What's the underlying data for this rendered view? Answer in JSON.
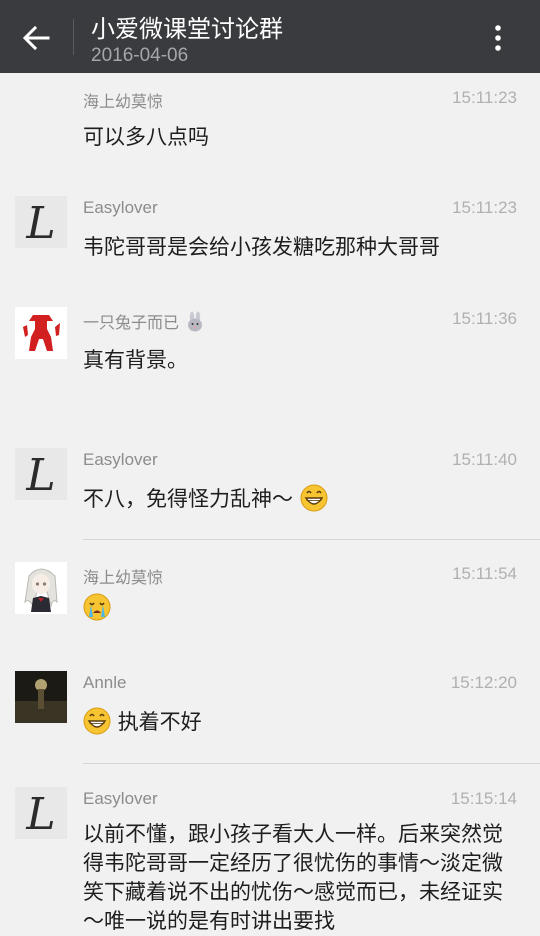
{
  "header": {
    "title": "小爱微课堂讨论群",
    "date": "2016-04-06",
    "back_icon": "arrow-left-icon",
    "more_icon": "more-vertical-icon"
  },
  "messages": [
    {
      "sender": "海上幼莫惊",
      "time": "15:11:23",
      "text": "可以多八点吗"
    },
    {
      "sender": "Easylover",
      "time": "15:11:23",
      "text": "韦陀哥哥是会给小孩发糖吃那种大哥哥"
    },
    {
      "sender": "一只兔子而已",
      "time": "15:11:36",
      "text": "真有背景。"
    },
    {
      "sender": "Easylover",
      "time": "15:11:40",
      "text": "不八，免得怪力乱神～"
    },
    {
      "sender": "海上幼莫惊",
      "time": "15:11:54",
      "text": ""
    },
    {
      "sender": "Annle",
      "time": "15:12:20",
      "text": "执着不好"
    },
    {
      "sender": "Easylover",
      "time": "15:15:14",
      "text": "以前不懂，跟小孩子看大人一样。后来突然觉得韦陀哥哥一定经历了很忧伤的事情～淡定微笑下藏着说不出的忧伤～感觉而已，未经证实～唯一说的是有时讲出要找"
    }
  ],
  "colors": {
    "topbar": "#3a3b3f",
    "background": "#f1f1f1",
    "emoji_yellow": "#f7c531"
  }
}
